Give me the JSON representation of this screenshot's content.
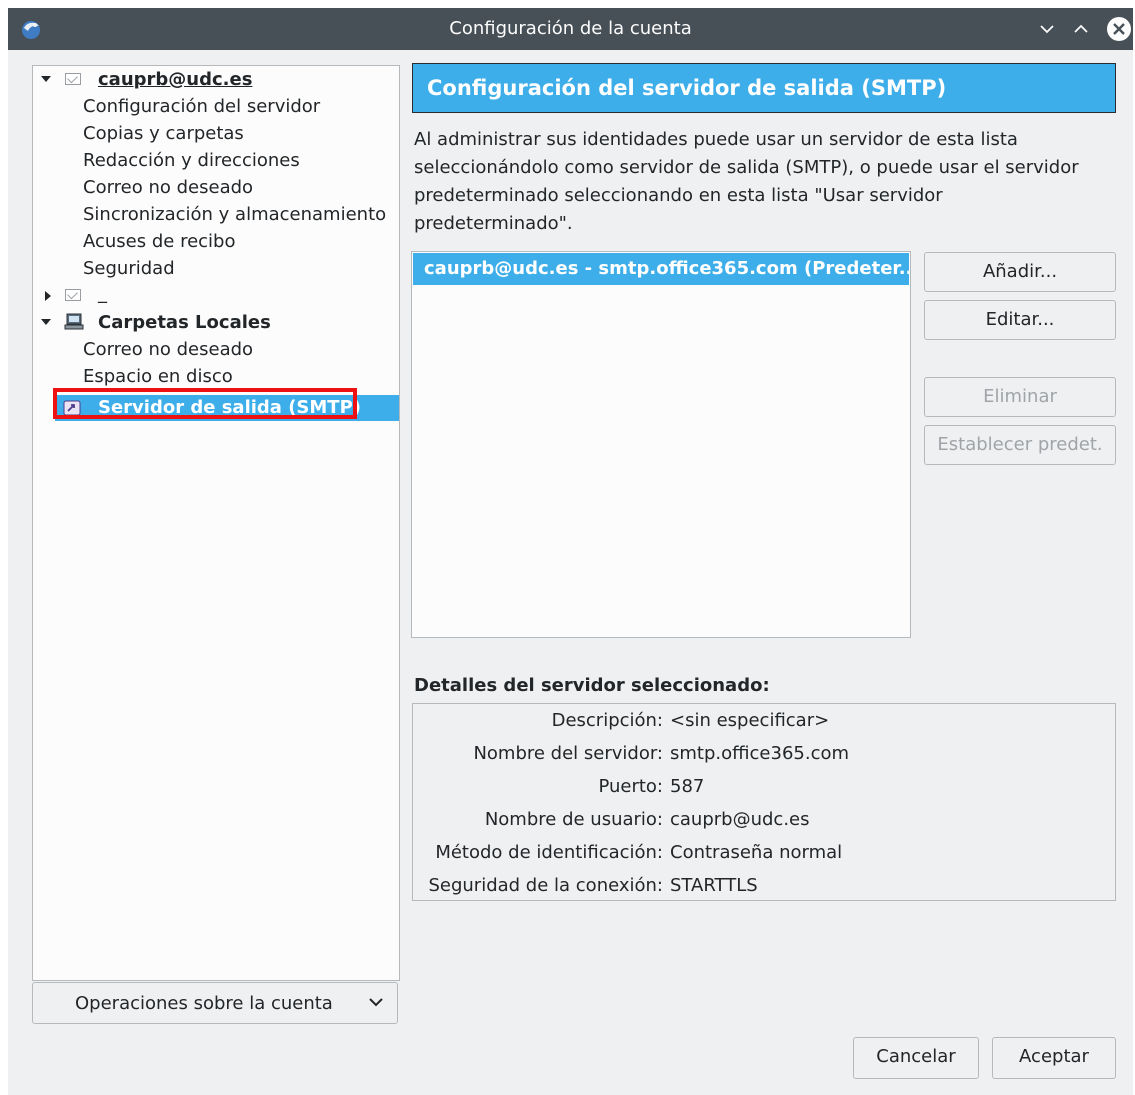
{
  "window": {
    "title": "Configuración de la cuenta",
    "icons": [
      "thunderbird-logo",
      "minimize-chevron-down",
      "maximize-chevron-up",
      "close-x"
    ]
  },
  "tree": {
    "account": {
      "label": "cauprb@udc.es",
      "children": [
        "Configuración del servidor",
        "Copias y carpetas",
        "Redacción y direcciones",
        "Correo no deseado",
        "Sincronización y almacenamiento",
        "Acuses de recibo",
        "Seguridad"
      ]
    },
    "collapsed_account_label": "_",
    "local_folders": {
      "label": "Carpetas Locales",
      "children": [
        "Correo no deseado",
        "Espacio en disco"
      ]
    },
    "smtp_item": "Servidor de salida (SMTP)"
  },
  "account_ops_button": "Operaciones sobre la cuenta",
  "panel": {
    "header": "Configuración del servidor de salida (SMTP)",
    "description_lines": [
      "Al administrar sus identidades puede usar un servidor de esta lista",
      "seleccionándolo como servidor de salida (SMTP), o puede usar el servidor",
      "predeterminado seleccionando en esta lista \"Usar servidor",
      "predeterminado\"."
    ],
    "server_list": [
      "cauprb@udc.es - smtp.office365.com (Predeter..."
    ],
    "buttons": {
      "add": "Añadir...",
      "edit": "Editar...",
      "delete": "Eliminar",
      "set_default": "Establecer predet."
    },
    "details_title": "Detalles del servidor seleccionado:",
    "details": [
      {
        "label": "Descripción:",
        "value": "<sin especificar>"
      },
      {
        "label": "Nombre del servidor:",
        "value": "smtp.office365.com"
      },
      {
        "label": "Puerto:",
        "value": "587"
      },
      {
        "label": "Nombre de usuario:",
        "value": "cauprb@udc.es"
      },
      {
        "label": "Método de identificación:",
        "value": "Contraseña normal"
      },
      {
        "label": "Seguridad de la conexión:",
        "value": "STARTTLS"
      }
    ]
  },
  "footer": {
    "cancel": "Cancelar",
    "accept": "Aceptar"
  },
  "colors": {
    "accent": "#3daee9",
    "titlebar": "#475057",
    "highlight_box": "#ee1111"
  }
}
